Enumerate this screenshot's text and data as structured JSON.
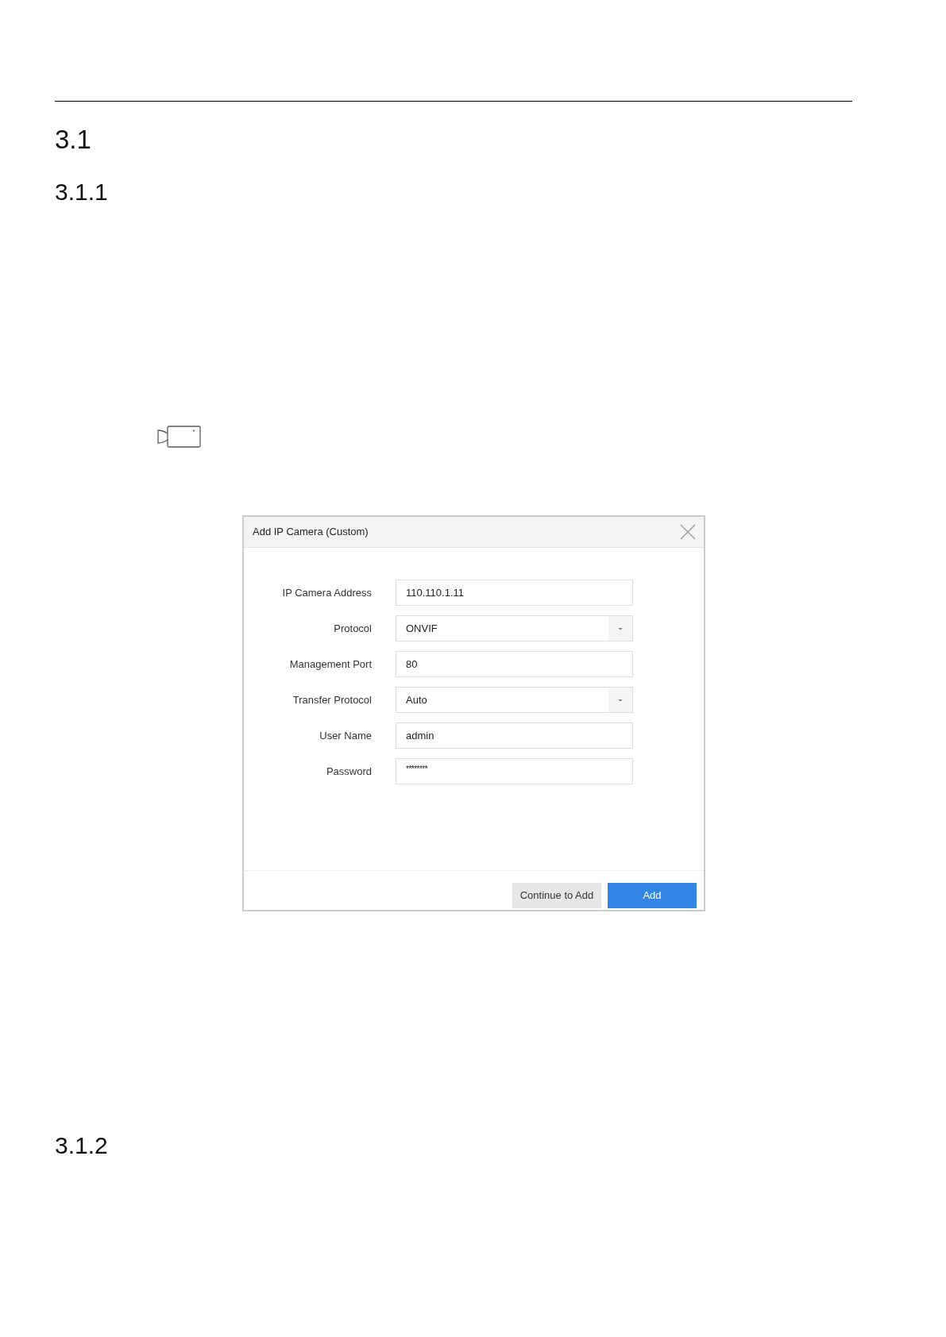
{
  "section_heading": "3.1",
  "subsection_heading": "3.1.1",
  "dialog": {
    "title": "Add IP Camera (Custom)",
    "fields": [
      {
        "label": "IP Camera Address",
        "kind": "text",
        "value": "110.110.1.11"
      },
      {
        "label": "Protocol",
        "kind": "select",
        "value": "ONVIF"
      },
      {
        "label": "Management Port",
        "kind": "text",
        "value": "80"
      },
      {
        "label": "Transfer Protocol",
        "kind": "select",
        "value": "Auto"
      },
      {
        "label": "User Name",
        "kind": "text",
        "value": "admin"
      },
      {
        "label": "Password",
        "kind": "password",
        "value": "********"
      }
    ],
    "buttons": [
      {
        "label": "Continue to Add",
        "kind": "secondary"
      },
      {
        "label": "Add",
        "kind": "primary"
      }
    ]
  },
  "next_subsection_heading": "3.1.2"
}
